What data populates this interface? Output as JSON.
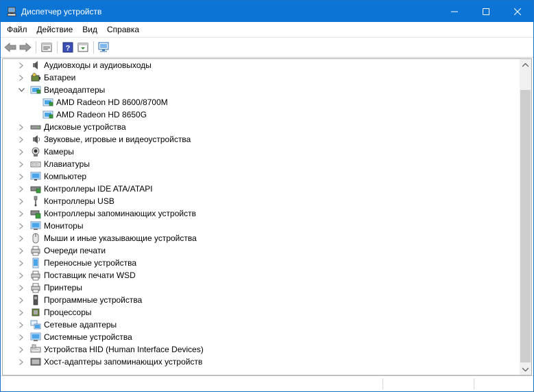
{
  "window": {
    "title": "Диспетчер устройств",
    "accent_color": "#0c74d4"
  },
  "menu": {
    "items": [
      {
        "label": "Файл"
      },
      {
        "label": "Действие"
      },
      {
        "label": "Вид"
      },
      {
        "label": "Справка"
      }
    ]
  },
  "toolbar": {
    "buttons": [
      "back-arrow-icon",
      "forward-arrow-icon",
      "properties-icon",
      "help-icon",
      "update-driver-icon",
      "scan-hardware-icon"
    ]
  },
  "tree": {
    "items": [
      {
        "label": "Аудиовходы и аудиовыходы",
        "icon": "audio-icon",
        "expanded": false
      },
      {
        "label": "Батареи",
        "icon": "battery-icon",
        "expanded": false
      },
      {
        "label": "Видеоадаптеры",
        "icon": "display-adapter-icon",
        "expanded": true,
        "children": [
          {
            "label": "AMD Radeon HD 8600/8700M",
            "icon": "display-adapter-icon"
          },
          {
            "label": "AMD Radeon HD 8650G",
            "icon": "display-adapter-icon"
          }
        ]
      },
      {
        "label": "Дисковые устройства",
        "icon": "disk-icon",
        "expanded": false
      },
      {
        "label": "Звуковые, игровые и видеоустройства",
        "icon": "sound-icon",
        "expanded": false
      },
      {
        "label": "Камеры",
        "icon": "camera-icon",
        "expanded": false
      },
      {
        "label": "Клавиатуры",
        "icon": "keyboard-icon",
        "expanded": false
      },
      {
        "label": "Компьютер",
        "icon": "computer-icon",
        "expanded": false
      },
      {
        "label": "Контроллеры IDE ATA/ATAPI",
        "icon": "ide-controller-icon",
        "expanded": false
      },
      {
        "label": "Контроллеры USB",
        "icon": "usb-icon",
        "expanded": false
      },
      {
        "label": "Контроллеры запоминающих устройств",
        "icon": "storage-controller-icon",
        "expanded": false
      },
      {
        "label": "Мониторы",
        "icon": "monitor-icon",
        "expanded": false
      },
      {
        "label": "Мыши и иные указывающие устройства",
        "icon": "mouse-icon",
        "expanded": false
      },
      {
        "label": "Очереди печати",
        "icon": "print-queue-icon",
        "expanded": false
      },
      {
        "label": "Переносные устройства",
        "icon": "portable-device-icon",
        "expanded": false
      },
      {
        "label": "Поставщик печати WSD",
        "icon": "wsd-printer-icon",
        "expanded": false
      },
      {
        "label": "Принтеры",
        "icon": "printer-icon",
        "expanded": false
      },
      {
        "label": "Программные устройства",
        "icon": "software-device-icon",
        "expanded": false
      },
      {
        "label": "Процессоры",
        "icon": "processor-icon",
        "expanded": false
      },
      {
        "label": "Сетевые адаптеры",
        "icon": "network-adapter-icon",
        "expanded": false
      },
      {
        "label": "Системные устройства",
        "icon": "system-device-icon",
        "expanded": false
      },
      {
        "label": "Устройства HID (Human Interface Devices)",
        "icon": "hid-icon",
        "expanded": false
      },
      {
        "label": "Хост-адаптеры запоминающих устройств",
        "icon": "storage-host-icon",
        "expanded": false
      }
    ]
  }
}
